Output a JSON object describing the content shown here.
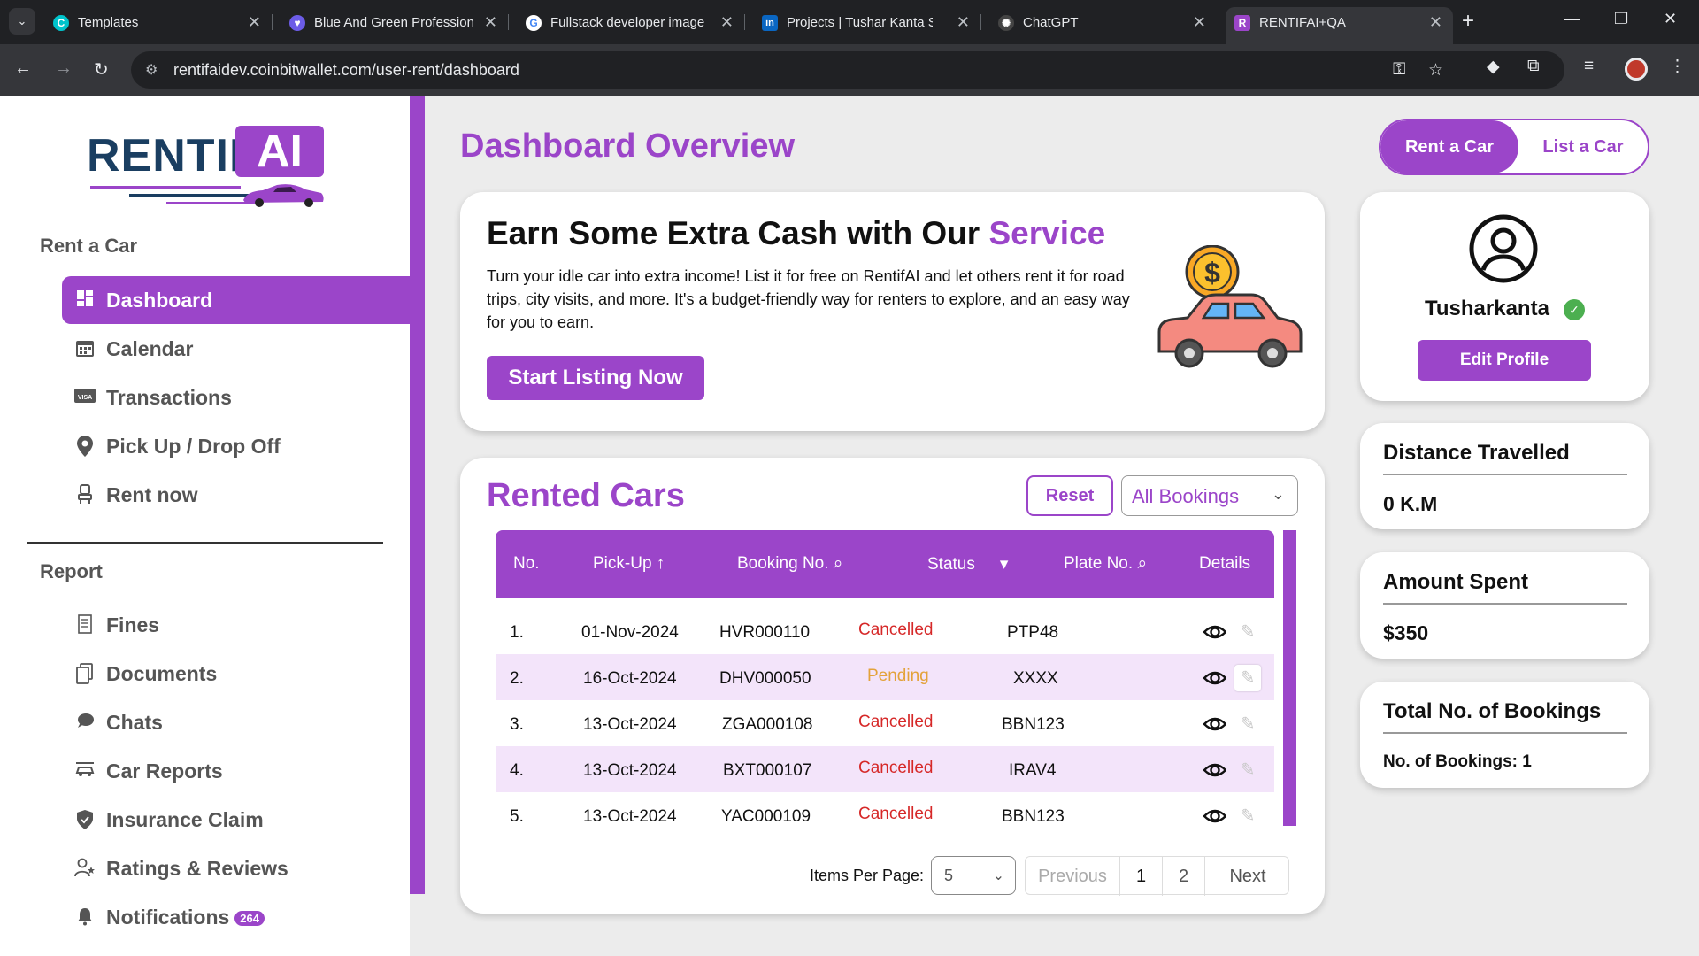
{
  "browser": {
    "tabs": [
      {
        "title": "Templates",
        "favicon_color": "#00c4cc",
        "favicon_letter": "C"
      },
      {
        "title": "Blue And Green Profession",
        "favicon_color": "#6c5ce7",
        "favicon_letter": "♥"
      },
      {
        "title": "Fullstack developer image",
        "favicon_color": "#ffffff",
        "favicon_letter": "G"
      },
      {
        "title": "Projects | Tushar Kanta Swa",
        "favicon_color": "#0a66c2",
        "favicon_letter": "in"
      },
      {
        "title": "ChatGPT",
        "favicon_color": "#444444",
        "favicon_letter": "✺"
      },
      {
        "title": "RENTIFAI+QA",
        "favicon_color": "#9b45c9",
        "favicon_letter": "R"
      }
    ],
    "url": "rentifaidev.coinbitwallet.com/user-rent/dashboard"
  },
  "logo": {
    "word1": "RENTIF",
    "word2": "AI"
  },
  "sidebar": {
    "rent_section": "Rent a Car",
    "rent_items": [
      {
        "label": "Dashboard",
        "icon": "dashboard-icon",
        "active": true
      },
      {
        "label": "Calendar",
        "icon": "calendar-icon"
      },
      {
        "label": "Transactions",
        "icon": "visa-card-icon"
      },
      {
        "label": "Pick Up / Drop Off",
        "icon": "location-pin-icon"
      },
      {
        "label": "Rent now",
        "icon": "car-seat-icon"
      }
    ],
    "report_section": "Report",
    "report_items": [
      {
        "label": "Fines",
        "icon": "document-icon"
      },
      {
        "label": "Documents",
        "icon": "documents-icon"
      },
      {
        "label": "Chats",
        "icon": "chat-icon"
      },
      {
        "label": "Car Reports",
        "icon": "car-report-icon"
      },
      {
        "label": "Insurance Claim",
        "icon": "shield-icon"
      },
      {
        "label": "Ratings & Reviews",
        "icon": "user-star-icon"
      },
      {
        "label": "Notifications",
        "icon": "bell-icon",
        "badge": "264"
      }
    ]
  },
  "header": {
    "title": "Dashboard Overview",
    "toggle": {
      "rent": "Rent a Car",
      "list": "List a Car"
    }
  },
  "hero": {
    "title_plain": "Earn Some Extra Cash with Our",
    "title_highlight": "Service",
    "body": "Turn your idle car into extra income! List it for free on RentifAI and let others rent it for road trips, city visits, and more. It's a budget-friendly way for renters to explore, and an easy way for you to earn.",
    "cta": "Start Listing Now"
  },
  "rented": {
    "title": "Rented Cars",
    "reset": "Reset",
    "filter_value": "All Bookings",
    "columns": {
      "no": "No.",
      "pickup": "Pick-Up",
      "booking": "Booking No.",
      "status": "Status",
      "plate": "Plate No.",
      "details": "Details"
    },
    "rows": [
      {
        "no": "1.",
        "pickup": "01-Nov-2024",
        "booking": "HVR000110",
        "status": "Cancelled",
        "plate": "PTP48"
      },
      {
        "no": "2.",
        "pickup": "16-Oct-2024",
        "booking": "DHV000050",
        "status": "Pending",
        "plate": "XXXX"
      },
      {
        "no": "3.",
        "pickup": "13-Oct-2024",
        "booking": "ZGA000108",
        "status": "Cancelled",
        "plate": "BBN123"
      },
      {
        "no": "4.",
        "pickup": "13-Oct-2024",
        "booking": "BXT000107",
        "status": "Cancelled",
        "plate": "IRAV4"
      },
      {
        "no": "5.",
        "pickup": "13-Oct-2024",
        "booking": "YAC000109",
        "status": "Cancelled",
        "plate": "BBN123"
      }
    ],
    "items_per_page_label": "Items Per Page:",
    "items_per_page": "5",
    "pagination": {
      "previous": "Previous",
      "pages": [
        "1",
        "2"
      ],
      "next": "Next"
    }
  },
  "profile": {
    "name": "Tusharkanta",
    "edit": "Edit Profile"
  },
  "stats": {
    "distance": {
      "label": "Distance Travelled",
      "value": "0 K.M"
    },
    "amount": {
      "label": "Amount Spent",
      "value": "$350"
    },
    "bookings": {
      "label": "Total No. of Bookings",
      "value": "No. of Bookings: 1"
    }
  },
  "colors": {
    "accent": "#9b45c9",
    "navy": "#1a3e61",
    "cancelled": "#d62828",
    "pending": "#e3a23a",
    "row_alt": "#f3e4fa"
  }
}
